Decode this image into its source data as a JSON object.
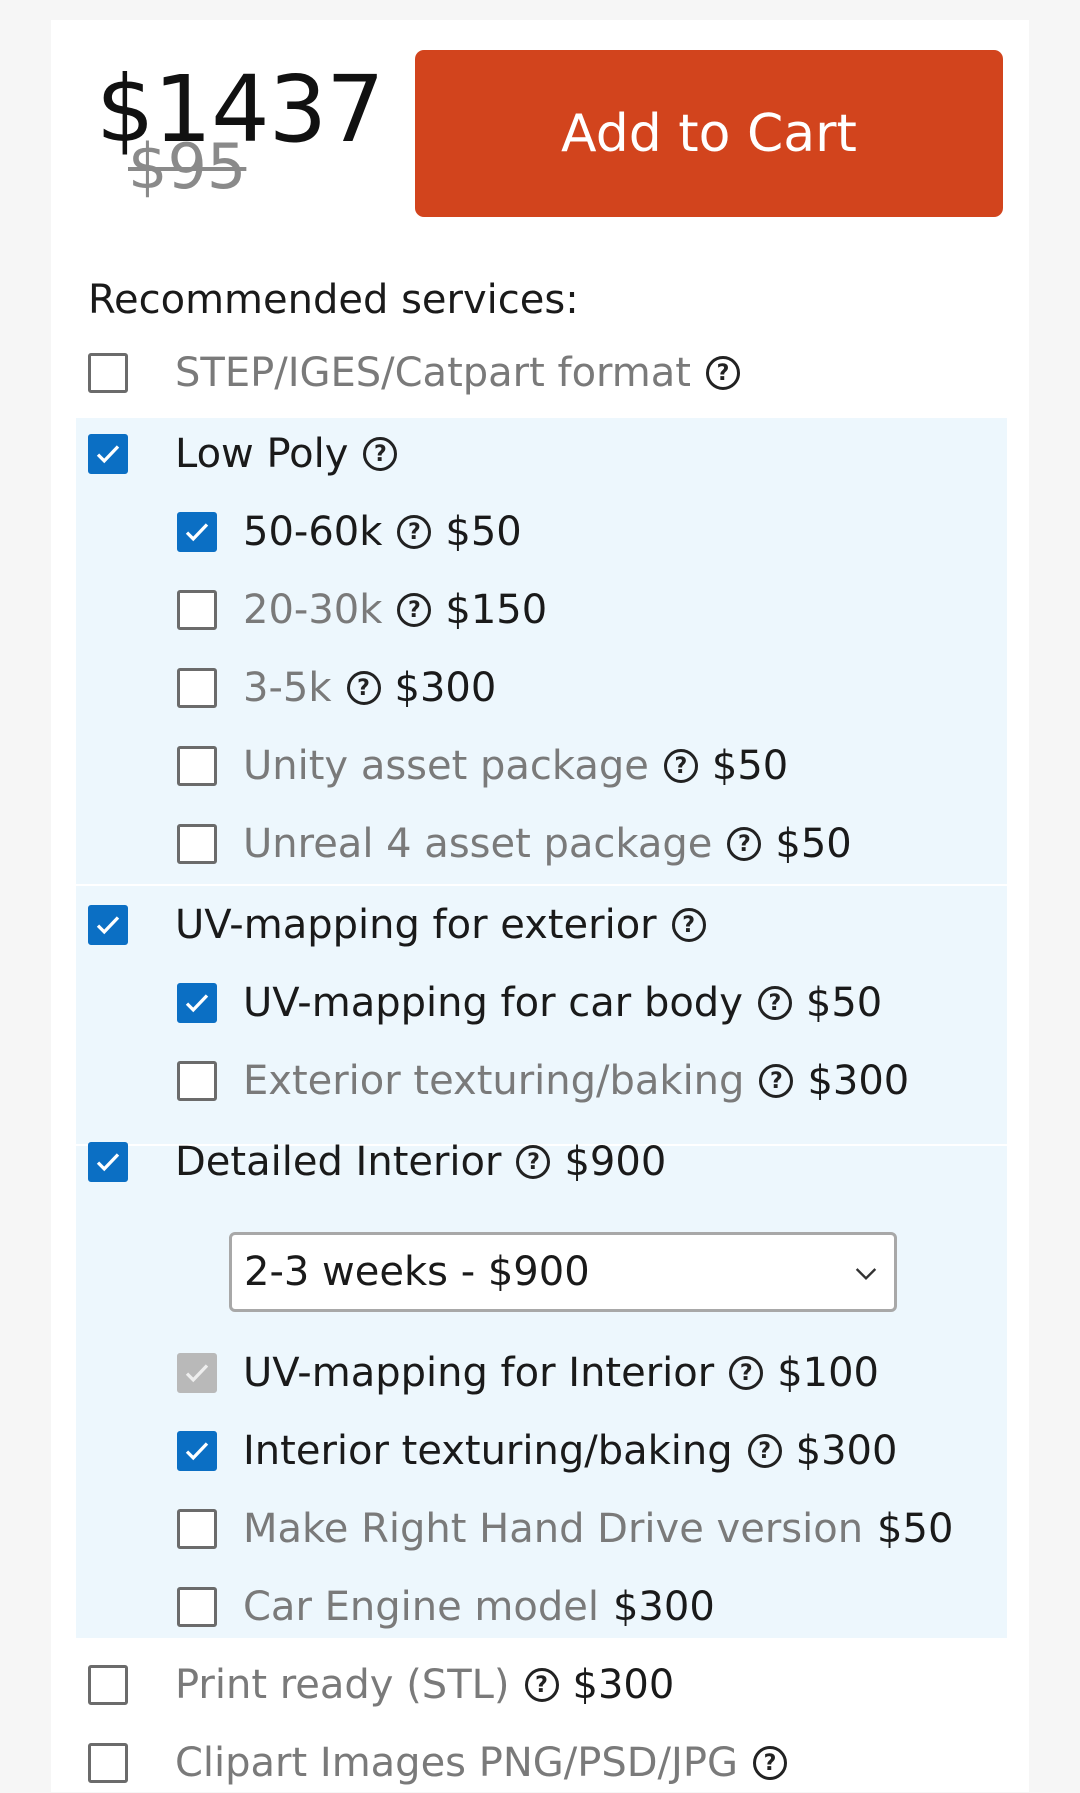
{
  "price": {
    "current": "$1437",
    "old": "$95"
  },
  "cart_button": "Add to Cart",
  "services": {
    "title": "Recommended services:",
    "items": [
      {
        "label": "STEP/IGES/Catpart format",
        "checked": false
      },
      {
        "label": "Low Poly",
        "checked": true
      },
      {
        "label": "50-60k",
        "price": "$50",
        "checked": true
      },
      {
        "label": "20-30k",
        "price": "$150",
        "checked": false
      },
      {
        "label": "3-5k",
        "price": "$300",
        "checked": false
      },
      {
        "label": "Unity asset package",
        "price": "$50",
        "checked": false
      },
      {
        "label": "Unreal 4 asset package",
        "price": "$50",
        "checked": false
      },
      {
        "label": "UV-mapping for exterior",
        "checked": true
      },
      {
        "label": "UV-mapping for car body",
        "price": "$50",
        "checked": true
      },
      {
        "label": "Exterior texturing/baking",
        "price": "$300",
        "checked": false
      },
      {
        "label": "Detailed Interior",
        "price": "$900",
        "checked": true
      },
      {
        "label": "UV-mapping for Interior",
        "price": "$100",
        "checked": true,
        "disabled": true
      },
      {
        "label": "Interior texturing/baking",
        "price": "$300",
        "checked": true
      },
      {
        "label": "Make Right Hand Drive version",
        "price": "$50",
        "checked": false
      },
      {
        "label": "Car Engine model",
        "price": "$300",
        "checked": false
      },
      {
        "label": "Print ready (STL)",
        "price": "$300",
        "checked": false
      },
      {
        "label": "Clipart Images PNG/PSD/JPG",
        "checked": false
      }
    ]
  },
  "interior_select": {
    "value": "2-3 weeks - $900"
  },
  "help_glyph": "?",
  "colors": {
    "accent": "#0b6fc4",
    "cart_button": "#d2441d",
    "group_background": "#edf7fd"
  }
}
